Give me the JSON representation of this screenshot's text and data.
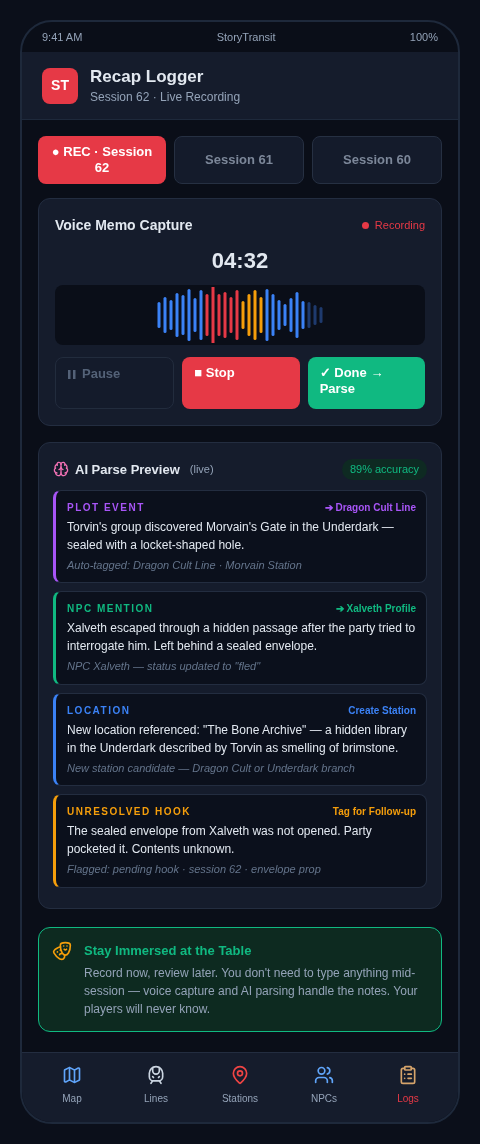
{
  "status_bar": {
    "time": "9:41 AM",
    "app": "StoryTransit",
    "battery": "100%"
  },
  "header": {
    "logo": "ST",
    "title": "Recap Logger",
    "subtitle": "Session 62 · Live Recording"
  },
  "sessions": [
    {
      "label": "● REC · Session 62",
      "selected": true
    },
    {
      "label": "Session 61",
      "selected": false
    },
    {
      "label": "Session 60",
      "selected": false
    }
  ],
  "recorder": {
    "title": "Voice Memo Capture",
    "status": "Recording",
    "recording": true,
    "timer": "04:32",
    "buttons": [
      {
        "kind": "pause",
        "label": "Pause",
        "disabled": true
      },
      {
        "kind": "stop",
        "label": "■ Stop",
        "disabled": false
      },
      {
        "kind": "done",
        "label": "✓ Done → Parse",
        "disabled": false
      }
    ]
  },
  "parse": {
    "title": "AI Parse Preview",
    "live": "(live)",
    "accuracy": "89% accuracy",
    "items": [
      {
        "category": "PLOT EVENT",
        "action": "➔ Dragon Cult Line",
        "color": "#a855f7",
        "text": "Torvin's group discovered Morvain's Gate in the Underdark — sealed with a locket-shaped hole.",
        "note": "Auto-tagged: Dragon Cult Line · Morvain Station"
      },
      {
        "category": "NPC MENTION",
        "action": "➔ Xalveth Profile",
        "color": "#10b981",
        "text": "Xalveth escaped through a hidden passage after the party tried to interrogate him. Left behind a sealed envelope.",
        "note": "NPC Xalveth — status updated to \"fled\""
      },
      {
        "category": "LOCATION",
        "action": "Create Station",
        "color": "#3b82f6",
        "text": "New location referenced: \"The Bone Archive\" — a hidden library in the Underdark described by Torvin as smelling of brimstone.",
        "note": "New station candidate — Dragon Cult or Underdark branch"
      },
      {
        "category": "UNRESOLVED HOOK",
        "action": "Tag for Follow-up",
        "color": "#f59e0b",
        "text": "The sealed envelope from Xalveth was not opened. Party pocketed it. Contents unknown.",
        "note": "Flagged: pending hook · session 62 · envelope prop"
      }
    ]
  },
  "tip": {
    "title": "Stay Immersed at the Table",
    "text": "Record now, review later. You don't need to type anything mid-session — voice capture and AI parsing handle the notes. Your players will never know."
  },
  "nav": [
    {
      "kind": "map",
      "label": "Map",
      "selected": false
    },
    {
      "kind": "lines",
      "label": "Lines",
      "selected": false
    },
    {
      "kind": "stations",
      "label": "Stations",
      "selected": false
    },
    {
      "kind": "npcs",
      "label": "NPCs",
      "selected": false
    },
    {
      "kind": "logs",
      "label": "Logs",
      "selected": true
    }
  ]
}
